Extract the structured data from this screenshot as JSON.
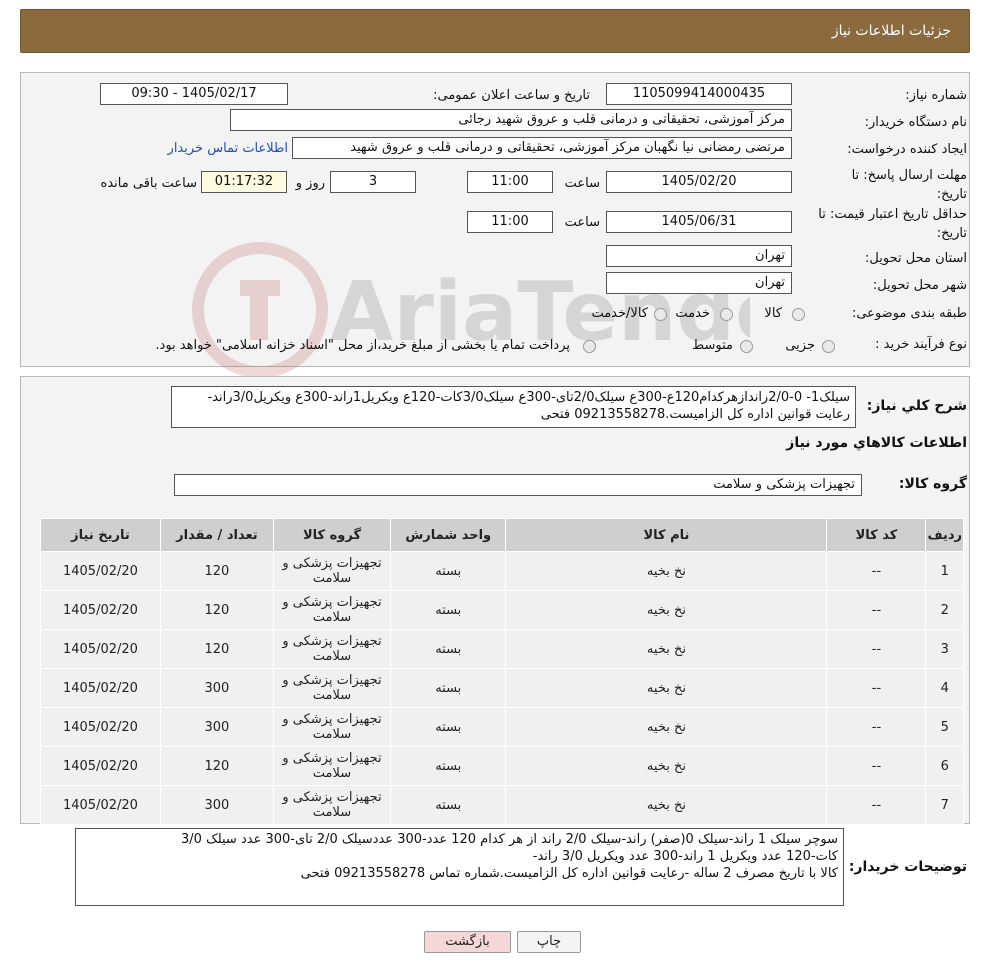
{
  "header": {
    "title": "جزئیات اطلاعات نیاز"
  },
  "form": {
    "need_number_label": "شماره نیاز:",
    "need_number": "1105099414000435",
    "announce_label": "تاریخ و ساعت اعلان عمومی:",
    "announce_value": "1405/02/17 - 09:30",
    "buyer_label": "نام دستگاه خریدار:",
    "buyer_value": "مرکز آموزشی، تحقیقاتی و درمانی قلب و عروق شهید رجائی",
    "creator_label": "ایجاد کننده درخواست:",
    "creator_value": "مرتضی رمضانی نیا نگهبان مرکز آموزشی، تحقیقاتی و درمانی قلب و عروق شهید",
    "contact_link": "اطلاعات تماس خریدار",
    "deadline_label": "مهلت ارسال پاسخ: تا تاریخ:",
    "deadline_date": "1405/02/20",
    "time_label": "ساعت",
    "deadline_time": "11:00",
    "days_value": "3",
    "days_label": "روز و",
    "remaining_value": "01:17:32",
    "remaining_label": "ساعت باقی مانده",
    "validity_label": "حداقل تاریخ اعتبار قیمت: تا تاریخ:",
    "validity_date": "1405/06/31",
    "validity_time": "11:00",
    "province_label": "استان محل تحویل:",
    "province_value": "تهران",
    "city_label": "شهر محل تحویل:",
    "city_value": "تهران",
    "category_label": "طبقه بندی موضوعی:",
    "category_options": [
      "کالا",
      "خدمت",
      "کالا/خدمت"
    ],
    "process_label": "نوع فرآیند خرید :",
    "process_options": [
      "جزیی",
      "متوسط"
    ],
    "process_note": "پرداخت تمام یا بخشی از مبلغ خرید،از محل \"اسناد خزانه اسلامی\" خواهد بود."
  },
  "summary": {
    "label": "شرح کلي نياز:",
    "text": "سیلک1- 0-2/0رانداز‌هرکدام120ع-300ع سیلک2/0تای-300ع سیلک3/0کات-120ع ویکریل1راند-300ع ویکریل3/0راند-رعایت قوانین اداره کل الزامیست.09213558278 فتحی"
  },
  "goods": {
    "section_title": "اطلاعات کالاهاي مورد نياز",
    "group_label": "گروه کالا:",
    "group_value": "تجهیزات پزشکی و سلامت",
    "columns": [
      "رديف",
      "کد کالا",
      "نام کالا",
      "واحد شمارش",
      "گروه کالا",
      "تعداد / مقدار",
      "تاريخ نياز"
    ],
    "rows": [
      {
        "idx": "1",
        "code": "--",
        "name": "نخ بخیه",
        "unit": "بسته",
        "group": "تجهیزات پزشکی و سلامت",
        "qty": "120",
        "date": "1405/02/20"
      },
      {
        "idx": "2",
        "code": "--",
        "name": "نخ بخیه",
        "unit": "بسته",
        "group": "تجهیزات پزشکی و سلامت",
        "qty": "120",
        "date": "1405/02/20"
      },
      {
        "idx": "3",
        "code": "--",
        "name": "نخ بخیه",
        "unit": "بسته",
        "group": "تجهیزات پزشکی و سلامت",
        "qty": "120",
        "date": "1405/02/20"
      },
      {
        "idx": "4",
        "code": "--",
        "name": "نخ بخیه",
        "unit": "بسته",
        "group": "تجهیزات پزشکی و سلامت",
        "qty": "300",
        "date": "1405/02/20"
      },
      {
        "idx": "5",
        "code": "--",
        "name": "نخ بخیه",
        "unit": "بسته",
        "group": "تجهیزات پزشکی و سلامت",
        "qty": "300",
        "date": "1405/02/20"
      },
      {
        "idx": "6",
        "code": "--",
        "name": "نخ بخیه",
        "unit": "بسته",
        "group": "تجهیزات پزشکی و سلامت",
        "qty": "120",
        "date": "1405/02/20"
      },
      {
        "idx": "7",
        "code": "--",
        "name": "نخ بخیه",
        "unit": "بسته",
        "group": "تجهیزات پزشکی و سلامت",
        "qty": "300",
        "date": "1405/02/20"
      }
    ]
  },
  "buyer_notes": {
    "label": "توضیحات خریدار:",
    "line1": "سوچر سیلک 1 راند-سیلک 0(صفر) راند-سیلک 2/0 راند از هر کدام 120 عدد-300 عددسیلک 2/0 تای-300 عدد سیلک 3/0",
    "line2": "کات-120 عدد ویکریل 1 راند-300 عدد ویکریل 3/0 راند-",
    "line3": "کالا با تاریخ مصرف 2 ساله -رعایت قوانین اداره کل الزامیست.شماره تماس 09213558278 فتحی"
  },
  "buttons": {
    "print": "چاپ",
    "back": "بازگشت"
  },
  "colors": {
    "header": "#8b6a3d",
    "panel": "#f3f3f3",
    "link": "#1b4fc0",
    "back_button": "#f6d7d7"
  }
}
